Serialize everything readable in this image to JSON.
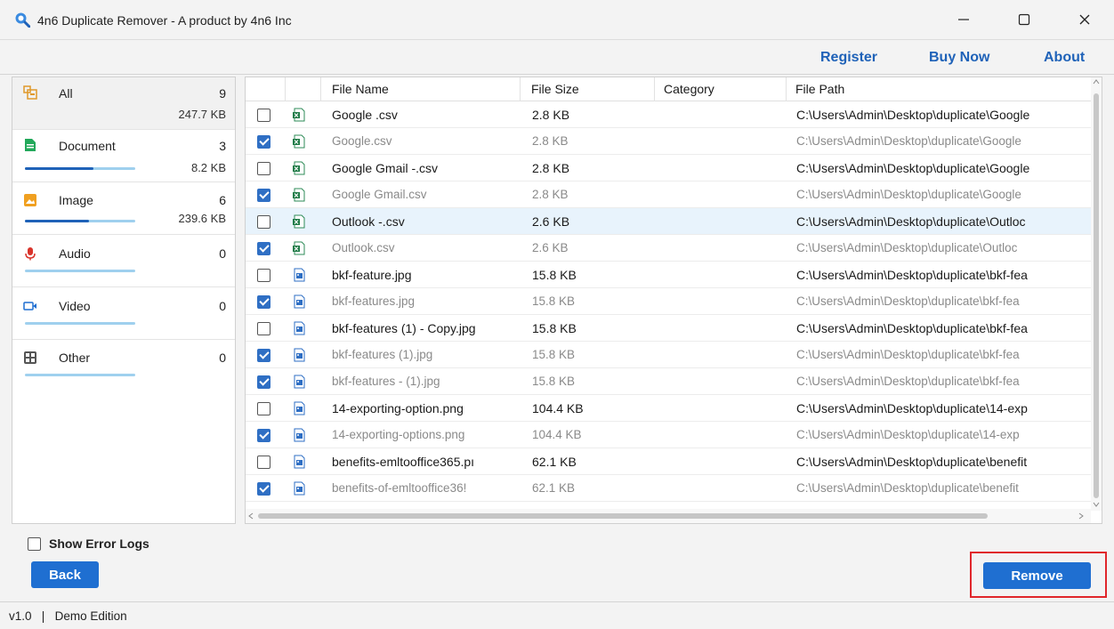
{
  "window": {
    "title": "4n6 Duplicate Remover - A product by 4n6 Inc",
    "minimize": "—",
    "maximize": "☐",
    "close": "✕"
  },
  "menu": {
    "register": "Register",
    "buy_now": "Buy Now",
    "about": "About"
  },
  "sidebar": {
    "categories": [
      {
        "label": "All",
        "count": "9",
        "size": "247.7 KB",
        "icon": "all-files-icon",
        "progress": null
      },
      {
        "label": "Document",
        "count": "3",
        "size": "8.2 KB",
        "icon": "document-icon",
        "progress": 0.62
      },
      {
        "label": "Image",
        "count": "6",
        "size": "239.6 KB",
        "icon": "image-icon",
        "progress": 0.58
      },
      {
        "label": "Audio",
        "count": "0",
        "size": "",
        "icon": "microphone-icon",
        "progress": 0
      },
      {
        "label": "Video",
        "count": "0",
        "size": "",
        "icon": "video-icon",
        "progress": 0
      },
      {
        "label": "Other",
        "count": "0",
        "size": "",
        "icon": "other-icon",
        "progress": 0
      }
    ]
  },
  "table": {
    "columns": {
      "name": "File Name",
      "size": "File Size",
      "category": "Category",
      "path": "File Path"
    },
    "rows": [
      {
        "checked": false,
        "dup": false,
        "type": "csv",
        "name": "Google .csv",
        "size": "2.8 KB",
        "path": "C:\\Users\\Admin\\Desktop\\duplicate\\Google"
      },
      {
        "checked": true,
        "dup": true,
        "type": "csv",
        "name": "Google.csv",
        "size": "2.8 KB",
        "path": "C:\\Users\\Admin\\Desktop\\duplicate\\Google"
      },
      {
        "checked": false,
        "dup": false,
        "type": "csv",
        "name": "Google Gmail -.csv",
        "size": "2.8 KB",
        "path": "C:\\Users\\Admin\\Desktop\\duplicate\\Google"
      },
      {
        "checked": true,
        "dup": true,
        "type": "csv",
        "name": "Google Gmail.csv",
        "size": "2.8 KB",
        "path": "C:\\Users\\Admin\\Desktop\\duplicate\\Google"
      },
      {
        "checked": false,
        "dup": false,
        "type": "csv",
        "name": "Outlook -.csv",
        "size": "2.6 KB",
        "path": "C:\\Users\\Admin\\Desktop\\duplicate\\Outloc",
        "selected": true
      },
      {
        "checked": true,
        "dup": true,
        "type": "csv",
        "name": "Outlook.csv",
        "size": "2.6 KB",
        "path": "C:\\Users\\Admin\\Desktop\\duplicate\\Outloc"
      },
      {
        "checked": false,
        "dup": false,
        "type": "img",
        "name": "bkf-feature.jpg",
        "size": "15.8 KB",
        "path": "C:\\Users\\Admin\\Desktop\\duplicate\\bkf-fea"
      },
      {
        "checked": true,
        "dup": true,
        "type": "img",
        "name": "bkf-features.jpg",
        "size": "15.8 KB",
        "path": "C:\\Users\\Admin\\Desktop\\duplicate\\bkf-fea"
      },
      {
        "checked": false,
        "dup": false,
        "type": "img",
        "name": "bkf-features (1) - Copy.jpg",
        "size": "15.8 KB",
        "path": "C:\\Users\\Admin\\Desktop\\duplicate\\bkf-fea"
      },
      {
        "checked": true,
        "dup": true,
        "type": "img",
        "name": "bkf-features (1).jpg",
        "size": "15.8 KB",
        "path": "C:\\Users\\Admin\\Desktop\\duplicate\\bkf-fea"
      },
      {
        "checked": true,
        "dup": true,
        "type": "img",
        "name": "bkf-features - (1).jpg",
        "size": "15.8 KB",
        "path": "C:\\Users\\Admin\\Desktop\\duplicate\\bkf-fea"
      },
      {
        "checked": false,
        "dup": false,
        "type": "img",
        "name": "14-exporting-option.png",
        "size": "104.4 KB",
        "path": "C:\\Users\\Admin\\Desktop\\duplicate\\14-exp"
      },
      {
        "checked": true,
        "dup": true,
        "type": "img",
        "name": "14-exporting-options.png",
        "size": "104.4 KB",
        "path": "C:\\Users\\Admin\\Desktop\\duplicate\\14-exp"
      },
      {
        "checked": false,
        "dup": false,
        "type": "img",
        "name": "benefits-emltooffice365.pı",
        "size": "62.1 KB",
        "path": "C:\\Users\\Admin\\Desktop\\duplicate\\benefit"
      },
      {
        "checked": true,
        "dup": true,
        "type": "img",
        "name": "benefits-of-emltooffice36!",
        "size": "62.1 KB",
        "path": "C:\\Users\\Admin\\Desktop\\duplicate\\benefit"
      }
    ]
  },
  "footer": {
    "show_error_logs": "Show Error Logs",
    "back": "Back",
    "remove": "Remove",
    "version": "v1.0",
    "separator": "|",
    "edition": "Demo Edition"
  },
  "colors": {
    "accent": "#1f6fd1",
    "link": "#1f62b8",
    "highlight_frame": "#e0262b",
    "selected_row": "#e8f3fc"
  }
}
